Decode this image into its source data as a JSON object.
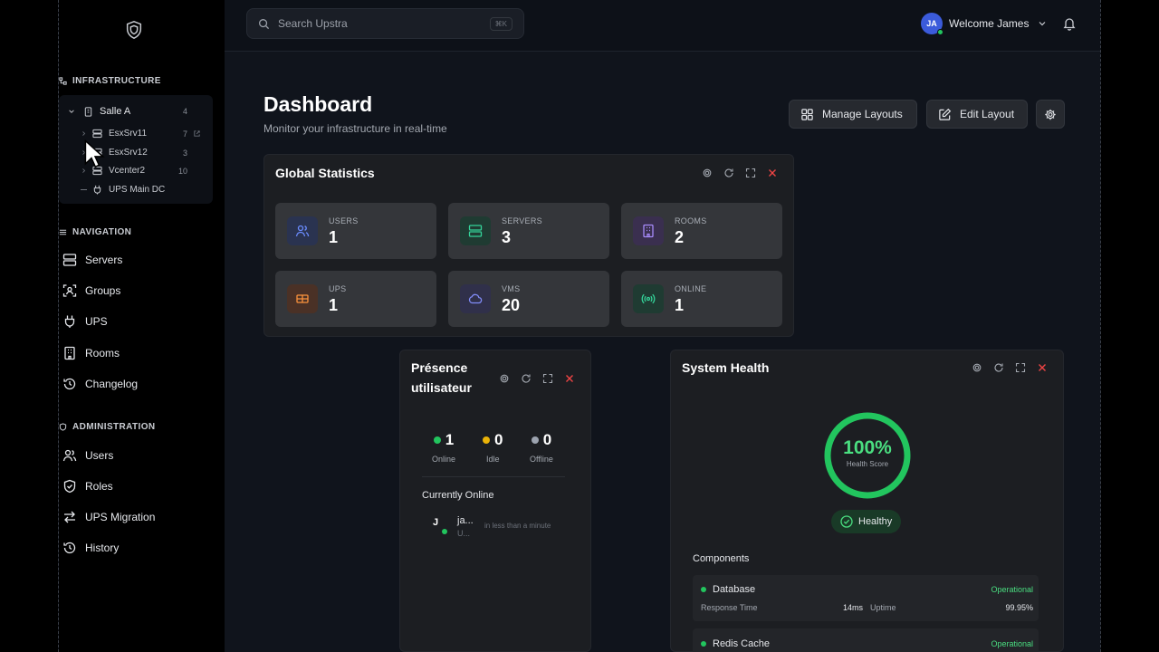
{
  "colors": {
    "accent_green": "#22c55e",
    "danger": "#ef4444",
    "brand_blue": "#3b5bdb"
  },
  "sidebar": {
    "infrastructure_title": "INFRASTRUCTURE",
    "tree": {
      "room": {
        "label": "Salle A",
        "count": "4"
      },
      "items": [
        {
          "label": "EsxSrv11",
          "count": "7",
          "icon": "server-icon"
        },
        {
          "label": "EsxSrv12",
          "count": "3",
          "icon": "server-icon"
        },
        {
          "label": "Vcenter2",
          "count": "10",
          "icon": "server-icon"
        },
        {
          "label": "UPS Main DC",
          "count": "",
          "icon": "plug-icon"
        }
      ]
    },
    "navigation_title": "NAVIGATION",
    "navigation": [
      {
        "label": "Servers",
        "icon": "server-icon"
      },
      {
        "label": "Groups",
        "icon": "groups-icon"
      },
      {
        "label": "UPS",
        "icon": "plug-icon"
      },
      {
        "label": "Rooms",
        "icon": "building-icon"
      },
      {
        "label": "Changelog",
        "icon": "history-icon"
      }
    ],
    "administration_title": "ADMINISTRATION",
    "administration": [
      {
        "label": "Users",
        "icon": "users-icon"
      },
      {
        "label": "Roles",
        "icon": "shield-icon"
      },
      {
        "label": "UPS Migration",
        "icon": "swap-icon"
      },
      {
        "label": "History",
        "icon": "history-icon"
      }
    ]
  },
  "topbar": {
    "search_placeholder": "Search Upstra",
    "search_shortcut": "⌘K",
    "avatar_initials": "JA",
    "welcome": "Welcome James"
  },
  "header": {
    "title": "Dashboard",
    "subtitle": "Monitor your infrastructure in real-time",
    "manage_layouts": "Manage Layouts",
    "edit_layout": "Edit Layout"
  },
  "global_stats": {
    "title": "Global Statistics",
    "stats": [
      {
        "label": "USERS",
        "value": "1",
        "color": "#6b8cff"
      },
      {
        "label": "SERVERS",
        "value": "3",
        "color": "#34d399"
      },
      {
        "label": "ROOMS",
        "value": "2",
        "color": "#a78bfa"
      },
      {
        "label": "UPS",
        "value": "1",
        "color": "#fb923c"
      },
      {
        "label": "VMS",
        "value": "20",
        "color": "#818cf8"
      },
      {
        "label": "ONLINE",
        "value": "1",
        "color": "#34d399"
      }
    ]
  },
  "presence": {
    "title_line1": "Présence",
    "title_line2": "utilisateur",
    "online": {
      "value": "1",
      "label": "Online"
    },
    "idle": {
      "value": "0",
      "label": "Idle"
    },
    "offline": {
      "value": "0",
      "label": "Offline"
    },
    "currently_online": "Currently Online",
    "user": {
      "initial": "J",
      "name": "ja...",
      "sub": "U...",
      "time": "in less than a minute"
    }
  },
  "health": {
    "title": "System Health",
    "score": "100%",
    "score_label": "Health Score",
    "score_fraction": 1.0,
    "status": "Healthy",
    "components_title": "Components",
    "components": [
      {
        "name": "Database",
        "status": "Operational",
        "rt_label": "Response Time",
        "rt_value": "14ms",
        "up_label": "Uptime",
        "up_value": "99.95%"
      },
      {
        "name": "Redis Cache",
        "status": "Operational"
      }
    ]
  }
}
